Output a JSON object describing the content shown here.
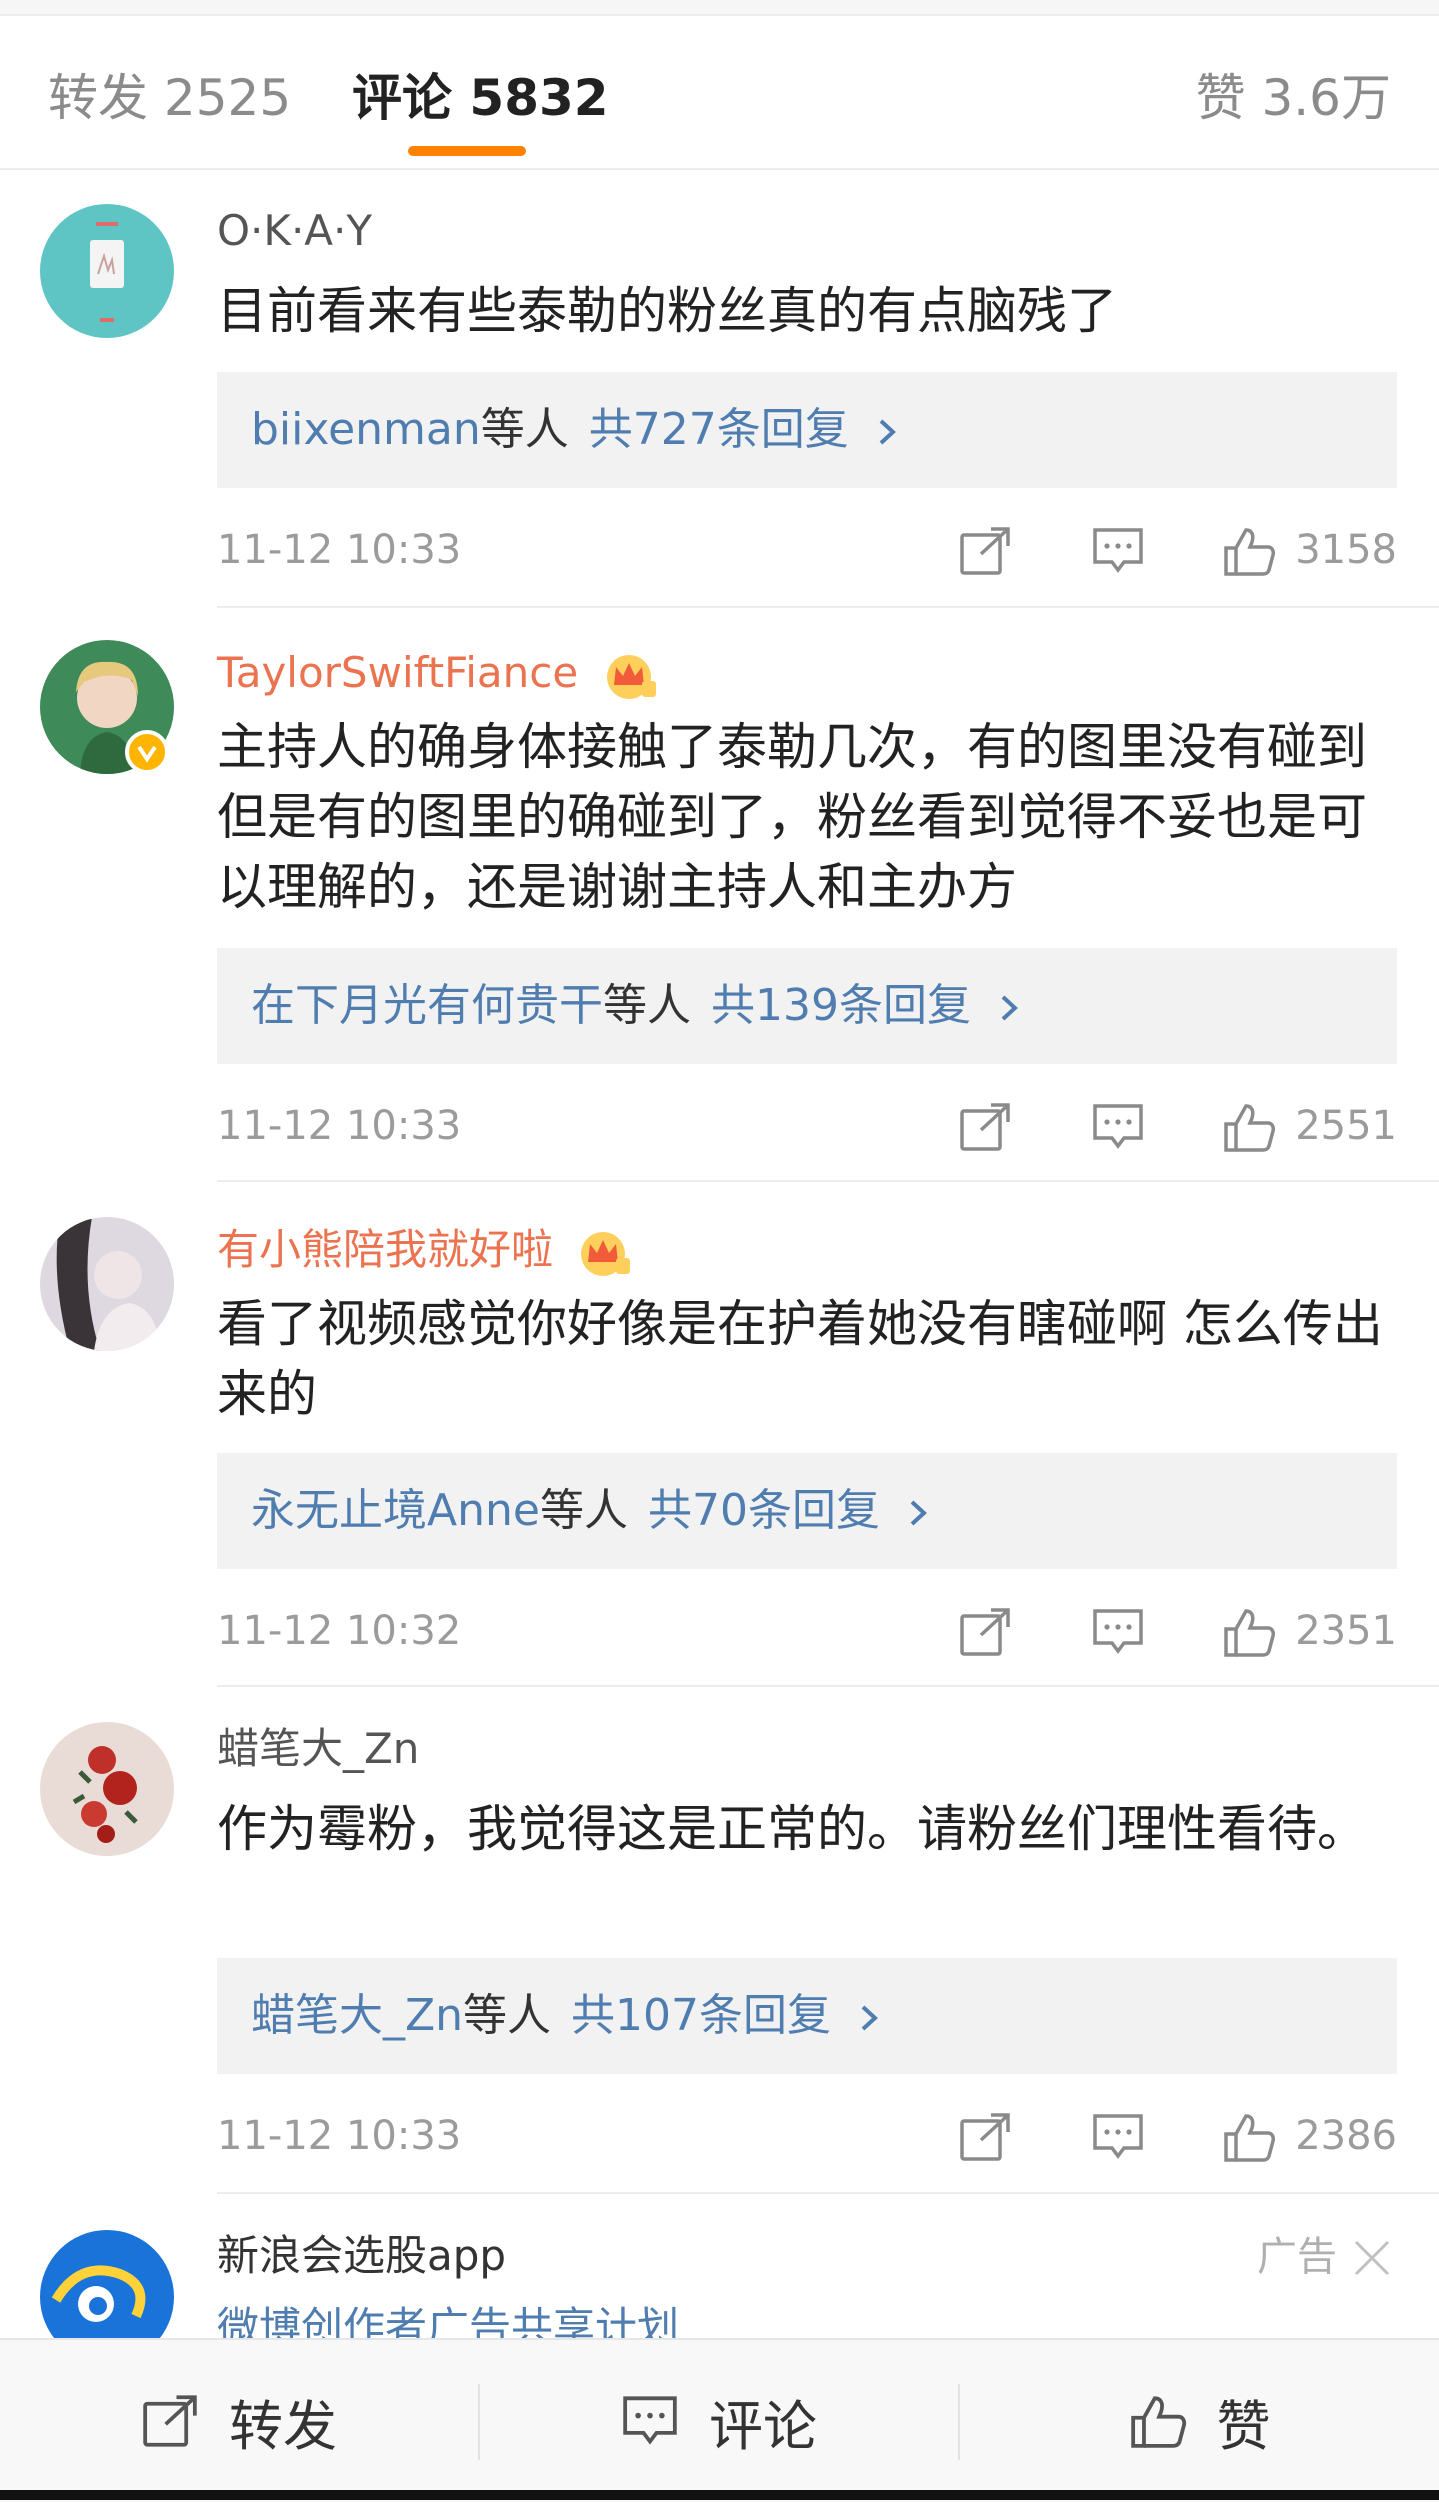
{
  "tabs": {
    "repost": "转发 2525",
    "comments": "评论 5832",
    "likes": "赞 3.6万"
  },
  "comments": [
    {
      "username": "O·K·A·Y",
      "text": "目前看来有些泰勒的粉丝真的有点脑残了",
      "reply_users": "biixenman",
      "reply_suffix": "等人",
      "reply_count": "共727条回复",
      "time": "11-12 10:33",
      "likes": "3158"
    },
    {
      "username": "TaylorSwiftFiance",
      "text": "主持人的确身体接触了泰勒几次，有的图里没有碰到但是有的图里的确碰到了，粉丝看到觉得不妥也是可以理解的，还是谢谢主持人和主办方",
      "reply_users": "在下月光有何贵干",
      "reply_suffix": "等人",
      "reply_count": "共139条回复",
      "time": "11-12 10:33",
      "likes": "2551"
    },
    {
      "username": "有小熊陪我就好啦",
      "text": "看了视频感觉你好像是在护着她没有瞎碰啊 怎么传出来的",
      "reply_users": "永无止境Anne",
      "reply_suffix": "等人",
      "reply_count": "共70条回复",
      "time": "11-12 10:32",
      "likes": "2351"
    },
    {
      "username": "蜡笔大_Zn",
      "text": "作为霉粉，我觉得这是正常的。请粉丝们理性看待。",
      "reply_users": "蜡笔大_Zn",
      "reply_suffix": "等人",
      "reply_count": "共107条回复",
      "time": "11-12 10:33",
      "likes": "2386"
    }
  ],
  "ad": {
    "title": "新浪会选股app",
    "label": "广告",
    "subtitle": "微博创作者广告共享计划"
  },
  "bottom_bar": {
    "repost": "转发",
    "comment": "评论",
    "like": "赞"
  },
  "colors": {
    "accent": "#ff8200",
    "vip_name": "#eb7350",
    "link_blue": "#507daf"
  }
}
